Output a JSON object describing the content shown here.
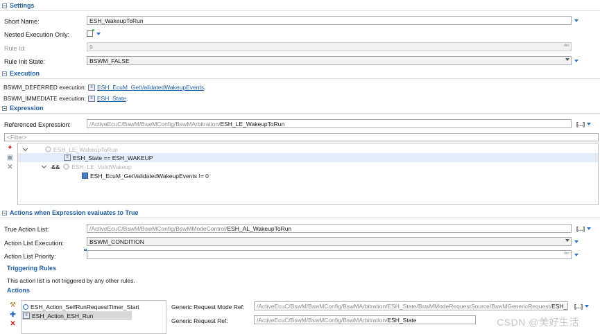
{
  "settings": {
    "title": "Settings",
    "short_name_label": "Short Name:",
    "short_name_value": "ESH_WakeupToRun",
    "nested_label": "Nested Execution Only:",
    "rule_id_label": "Rule Id:",
    "rule_id_value": "9",
    "rule_id_unit": "dec",
    "rule_init_label": "Rule Init State:",
    "rule_init_value": "BSWM_FALSE"
  },
  "execution": {
    "title": "Execution",
    "deferred_label": "BSWM_DEFERRED execution:",
    "deferred_link": "ESH_EcuM_GetValidatedWakeupEvents",
    "deferred_suffix": ".",
    "immediate_label": "BSWM_IMMEDIATE execution:",
    "immediate_link": "ESH_State",
    "immediate_suffix": "."
  },
  "expression": {
    "title": "Expression",
    "ref_label": "Referenced Expression:",
    "ref_path_grey": "/ActiveEcuC/BswM/BswMConfig/BswMArbitration/",
    "ref_path_dark": "ESH_LE_WakeupToRun",
    "ellipsis": "[...]",
    "filter_placeholder": "<Filter>",
    "tree": [
      {
        "text": "ESH_LE_WakeupToRun",
        "op": ""
      },
      {
        "text": "ESH_State == ESH_WAKEUP",
        "op": ""
      },
      {
        "text": "ESH_LE_ValidWakeup",
        "op": "&&"
      },
      {
        "text": "ESH_EcuM_GetValidatedWakeupEvents != 0",
        "op": ""
      }
    ]
  },
  "actions_true": {
    "title": "Actions when Expression evaluates to True",
    "true_list_label": "True Action List:",
    "true_list_grey": "/ActiveEcuC/BswM/BswMConfig/BswMModeControl/",
    "true_list_dark": "ESH_AL_WakeupToRun",
    "ellipsis": "[...]",
    "exec_label": "Action List Execution:",
    "exec_value": "BSWM_CONDITION",
    "priority_label": "Action List Priority:",
    "priority_unit": "dec"
  },
  "triggering": {
    "title": "Triggering Rules",
    "text": "This action list is not triggered by any other rules."
  },
  "actions": {
    "title": "Actions",
    "items": [
      "ESH_Action_SelfRunRequestTimer_Start",
      "ESH_Action_ESH_Run"
    ],
    "generic_mode_ref_label": "Generic Request Mode Ref:",
    "generic_mode_ref_grey": "/ActiveEcuC/BswM/BswMConfig/BswMArbitration/ESH_State/BswMModeRequestSource/BswMGenericRequest/",
    "generic_mode_ref_dark": "ESH_RUN",
    "generic_ref_label": "Generic Request Ref:",
    "generic_ref_grey": "/ActiveEcuC/BswM/BswMConfig/BswMArbitration/",
    "generic_ref_dark": "ESH_State",
    "ellipsis": "[...]"
  },
  "watermark": "CSDN @美好生活"
}
